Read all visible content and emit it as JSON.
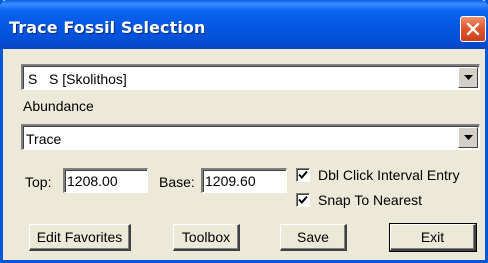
{
  "window": {
    "title": "Trace Fossil Selection"
  },
  "fossil_select": {
    "value": "S   S [Skolithos]"
  },
  "abundance": {
    "label": "Abundance",
    "value": "Trace"
  },
  "interval": {
    "top_label": "Top:",
    "top_value": "1208.00",
    "base_label": "Base:",
    "base_value": "1209.60"
  },
  "options": {
    "dbl_click_label": "Dbl Click Interval Entry",
    "dbl_click_checked": true,
    "snap_label": "Snap To Nearest",
    "snap_checked": true
  },
  "buttons": {
    "edit_favorites": "Edit Favorites",
    "toolbox": "Toolbox",
    "save": "Save",
    "exit": "Exit"
  },
  "icons": {
    "close": "close-icon",
    "dropdown": "chevron-down-icon",
    "check": "checkmark-icon"
  },
  "colors": {
    "titlebar": "#0457e0",
    "close_button": "#e2582f",
    "dialog_face": "#ece9d8"
  }
}
